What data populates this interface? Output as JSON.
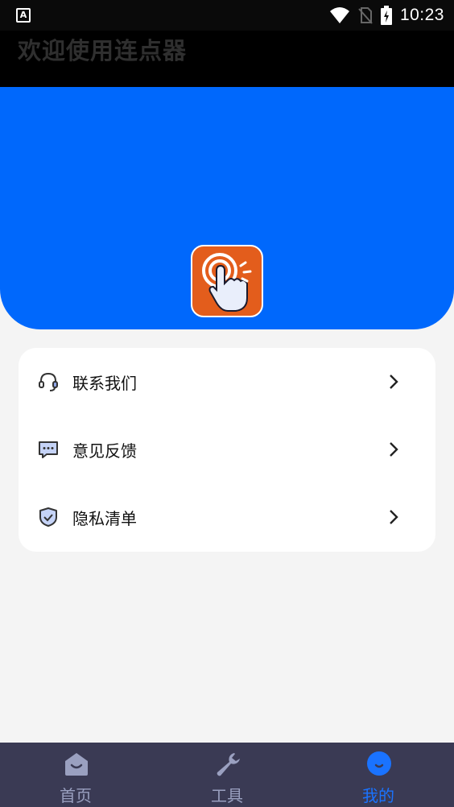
{
  "status_bar": {
    "left_icon_letter": "A",
    "time": "10:23",
    "icons": [
      "wifi-icon",
      "no-sim-icon",
      "battery-charging-icon"
    ]
  },
  "header": {
    "title": "欢迎使用连点器"
  },
  "banner": {
    "color": "#0068fc",
    "logo_icon": "tap-hand-icon"
  },
  "menu": {
    "items": [
      {
        "label": "联系我们",
        "icon": "headset-icon"
      },
      {
        "label": "意见反馈",
        "icon": "chat-bubble-icon"
      },
      {
        "label": "隐私清单",
        "icon": "shield-check-icon"
      }
    ]
  },
  "bottom_nav": {
    "items": [
      {
        "label": "首页",
        "icon": "home-icon",
        "active": false
      },
      {
        "label": "工具",
        "icon": "wrench-icon",
        "active": false
      },
      {
        "label": "我的",
        "icon": "profile-face-icon",
        "active": true
      }
    ],
    "active_color": "#1a73ff",
    "inactive_color": "#9aa0c0"
  }
}
